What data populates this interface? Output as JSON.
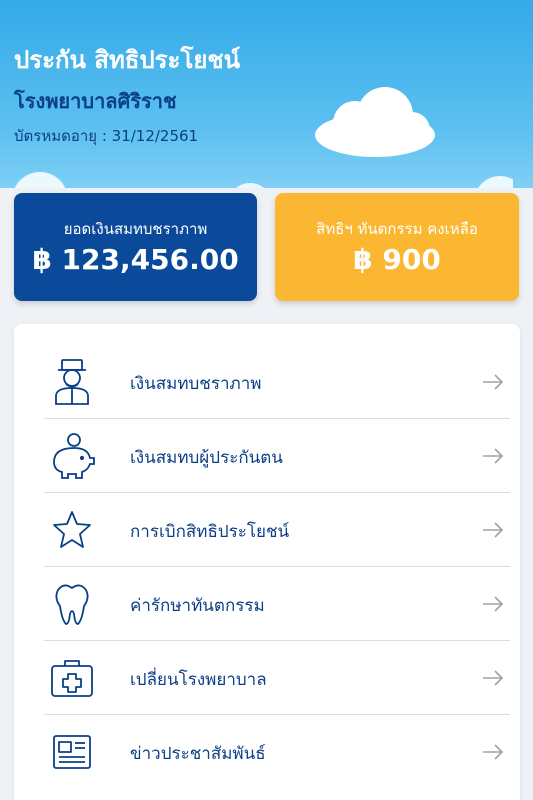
{
  "header": {
    "title": "ประกัน สิทธิประโยชน์",
    "hospital": "โรงพยาบาลศิริราช",
    "expiry": "บัตรหมดอายุ : 31/12/2561"
  },
  "cards": {
    "pension": {
      "label": "ยอดเงินสมทบชราภาพ",
      "value": "฿ 123,456.00"
    },
    "dental": {
      "label": "สิทธิฯ ทันตกรรม คงเหลือ",
      "value": "฿ 900"
    }
  },
  "menu": {
    "items": [
      {
        "label": "เงินสมทบชราภาพ",
        "icon": "elderly-person-icon"
      },
      {
        "label": "เงินสมทบผู้ประกันตน",
        "icon": "piggy-bank-icon"
      },
      {
        "label": "การเบิกสิทธิประโยชน์",
        "icon": "star-icon"
      },
      {
        "label": "ค่ารักษาทันตกรรม",
        "icon": "tooth-icon"
      },
      {
        "label": "เปลี่ยนโรงพยาบาล",
        "icon": "first-aid-kit-icon"
      },
      {
        "label": "ข่าวประชาสัมพันธ์",
        "icon": "newspaper-icon"
      }
    ]
  },
  "colors": {
    "primary": "#0b4a9a",
    "accent": "#fbb731",
    "sky": "#33aae8"
  }
}
